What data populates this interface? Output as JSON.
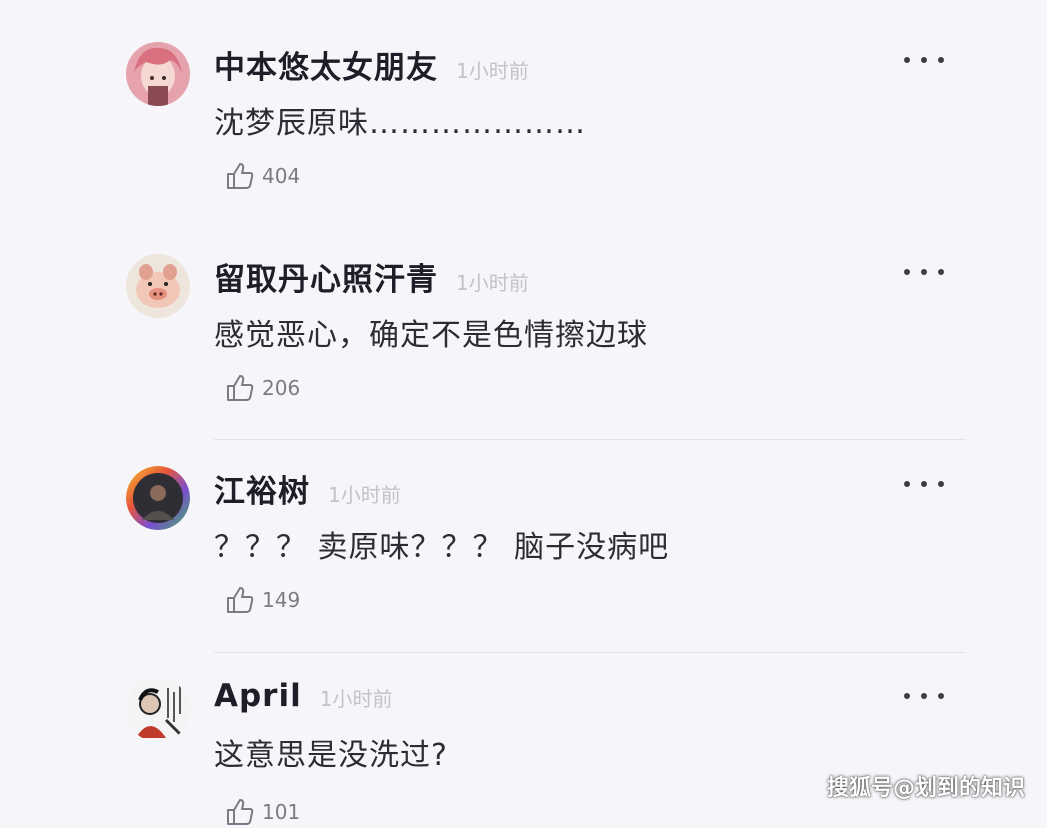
{
  "comments": [
    {
      "username": "中本悠太女朋友",
      "time": "1小时前",
      "text": "沈梦辰原味…………………",
      "likes": "404",
      "avatar": "pink-hair-avatar"
    },
    {
      "username": "留取丹心照汗青",
      "time": "1小时前",
      "text": "感觉恶心，确定不是色情擦边球",
      "likes": "206",
      "avatar": "pig-avatar"
    },
    {
      "username": "江裕树",
      "time": "1小时前",
      "text": "？？？ 卖原味？？？ 脑子没病吧",
      "likes": "149",
      "avatar": "rainbow-ring-avatar"
    },
    {
      "username": "April",
      "time": "1小时前",
      "text": "这意思是没洗过?",
      "likes": "101",
      "avatar": "sketch-avatar"
    }
  ],
  "watermark": "搜狐号@划到的知识",
  "colors": {
    "background": "#f6f6fa",
    "username": "#1e1e28",
    "time": "#c2c2ca",
    "like": "#7b7b85"
  }
}
